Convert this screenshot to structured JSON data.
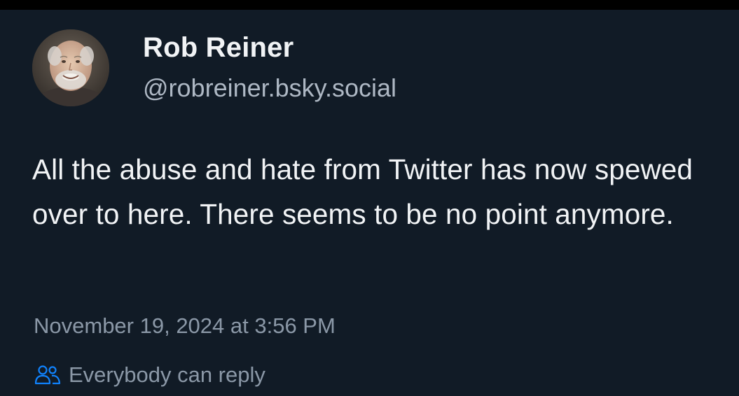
{
  "post": {
    "author": {
      "display_name": "Rob Reiner",
      "handle": "@robreiner.bsky.social"
    },
    "text": "All the abuse and hate from Twitter has now spewed over to here. There seems to be no point anymore.",
    "timestamp": "November 19, 2024 at 3:56 PM",
    "reply_setting": {
      "icon": "people-icon",
      "label": "Everybody can reply"
    }
  },
  "colors": {
    "background": "#111b26",
    "primary_text": "#f1f3f5",
    "secondary_text": "#8b98a7",
    "accent": "#1083fe"
  }
}
